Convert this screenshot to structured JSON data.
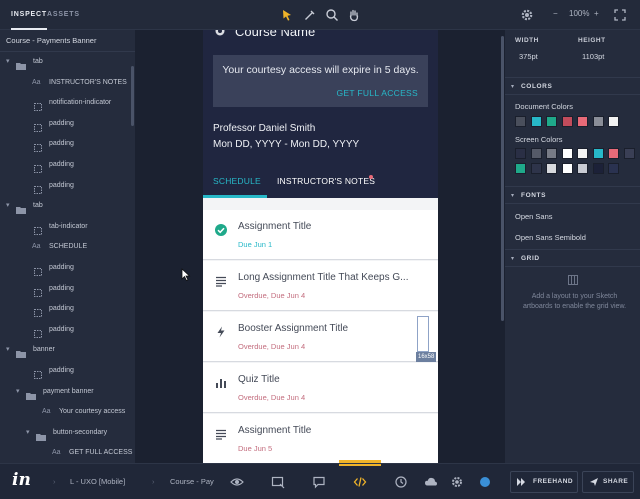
{
  "topbar": {
    "tabs": [
      {
        "label": "INSPECT",
        "active": true
      },
      {
        "label": "ASSETS",
        "active": false
      }
    ],
    "zoom_out": "−",
    "zoom_value": "100%",
    "zoom_in": "+"
  },
  "left_panel": {
    "breadcrumb": "Course - Payments Banner",
    "layers": [
      {
        "label": "tab",
        "kind": "folder",
        "indent": 0
      },
      {
        "label": "INSTRUCTOR'S NOTES",
        "kind": "text",
        "indent": 1
      },
      {
        "label": "notification-indicator",
        "kind": "shape",
        "indent": 1
      },
      {
        "label": "padding",
        "kind": "shape",
        "indent": 1
      },
      {
        "label": "padding",
        "kind": "shape",
        "indent": 1
      },
      {
        "label": "padding",
        "kind": "shape",
        "indent": 1
      },
      {
        "label": "padding",
        "kind": "shape",
        "indent": 1
      },
      {
        "label": "tab",
        "kind": "folder",
        "indent": 0
      },
      {
        "label": "tab-indicator",
        "kind": "shape",
        "indent": 1
      },
      {
        "label": "SCHEDULE",
        "kind": "text",
        "indent": 1
      },
      {
        "label": "padding",
        "kind": "shape",
        "indent": 1
      },
      {
        "label": "padding",
        "kind": "shape",
        "indent": 1
      },
      {
        "label": "padding",
        "kind": "shape",
        "indent": 1
      },
      {
        "label": "padding",
        "kind": "shape",
        "indent": 1
      },
      {
        "label": "banner",
        "kind": "folder",
        "indent": 0
      },
      {
        "label": "padding",
        "kind": "shape",
        "indent": 1
      },
      {
        "label": "payment banner",
        "kind": "folder",
        "indent": 1
      },
      {
        "label": "Your courtesy access",
        "kind": "text",
        "indent": 2
      },
      {
        "label": "button-secondary",
        "kind": "folder",
        "indent": 2
      },
      {
        "label": "GET FULL ACCESS",
        "kind": "text",
        "indent": 3
      }
    ]
  },
  "phone": {
    "course_name": "Course Name",
    "banner_message": "Your courtesy access will expire in 5 days.",
    "banner_link": "GET FULL ACCESS",
    "professor": "Professor Daniel Smith",
    "date_range": "Mon DD, YYYY - Mon DD, YYYY",
    "tabs": [
      "SCHEDULE",
      "INSTRUCTOR'S NOTES"
    ],
    "assignments": [
      {
        "title": "Assignment Title",
        "status": "Due Jun 1",
        "icon": "check-circle-icon",
        "status_color": "#27b8c8"
      },
      {
        "title": "Long Assignment Title That Keeps G...",
        "status": "Overdue, Due Jun 4",
        "icon": "lines-icon",
        "status_color": "#c36d7e"
      },
      {
        "title": "Booster Assignment Title",
        "status": "Overdue, Due Jun 4",
        "icon": "bolt-icon",
        "status_color": "#c36d7e"
      },
      {
        "title": "Quiz Title",
        "status": "Overdue, Due Jun 4",
        "icon": "bar-chart-icon",
        "status_color": "#c36d7e"
      },
      {
        "title": "Assignment Title",
        "status": "Due Jun 5",
        "icon": "lines-icon",
        "status_color": "#c36d7e"
      }
    ],
    "selection_size": "16x58"
  },
  "right_panel": {
    "width_label": "WIDTH",
    "width_value": "375pt",
    "height_label": "HEIGHT",
    "height_value": "1103pt",
    "colors_header": "COLORS",
    "document_colors_label": "Document Colors",
    "document_colors": [
      "#4a4f5c",
      "#27b8c8",
      "#1fa98a",
      "#c24c5c",
      "#e86a78",
      "#8a8e98",
      "#f2f2f2"
    ],
    "screen_colors_label": "Screen Colors",
    "screen_colors_row1": [
      "#2a2f45",
      "#555a68",
      "#777b86",
      "#ffffff",
      "#f4f4f4",
      "#27b8c8",
      "#e86a78",
      "#3a3f55"
    ],
    "screen_colors_row2": [
      "#1fa98a",
      "#2e344a",
      "#d8dade",
      "#ffffff",
      "#c9ccd4",
      "#1c2138",
      "#2a3250"
    ],
    "fonts_header": "FONTS",
    "fonts": [
      "Open Sans",
      "Open Sans Semibold"
    ],
    "grid_header": "GRID",
    "grid_hint": "Add a layout to your Sketch artboards to enable the grid view."
  },
  "bottombar": {
    "project": "L - UXO [Mobile]",
    "screen": "Course - Pay",
    "freehand_label": "FREEHAND",
    "share_label": "SHARE"
  }
}
